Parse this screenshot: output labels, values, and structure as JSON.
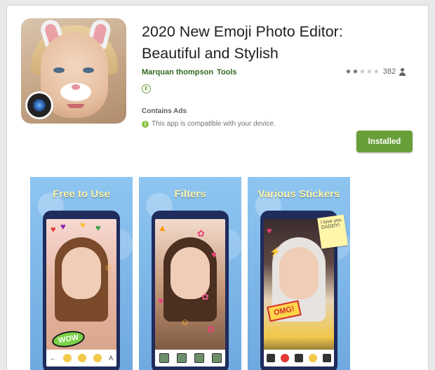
{
  "app": {
    "title_line1": "2020 New Emoji Photo Editor:",
    "title_line2": "Beautiful and Stylish",
    "developer": "Marquan thompson",
    "category": "Tools",
    "rating_stars_filled": 2,
    "rating_stars_total": 5,
    "rating_count": "382",
    "content_rating_badge": "E",
    "contains_ads": "Contains Ads",
    "compatibility": "This app is compatible with your device.",
    "install_button": "Installed"
  },
  "screenshots": [
    {
      "label": "Free to Use",
      "sticker_text": "WOW"
    },
    {
      "label": "Filters"
    },
    {
      "label": "Various Stickers",
      "sticker_text": "OMG!",
      "note_text": "I love you DADDY!"
    }
  ],
  "colors": {
    "accent_green": "#689f38",
    "link_green": "#33691e",
    "label_yellow": "#fff7a8"
  },
  "icons": {
    "rating_user": "person-icon",
    "compat_info": "info-icon",
    "content_rating": "everyone-badge-icon"
  }
}
